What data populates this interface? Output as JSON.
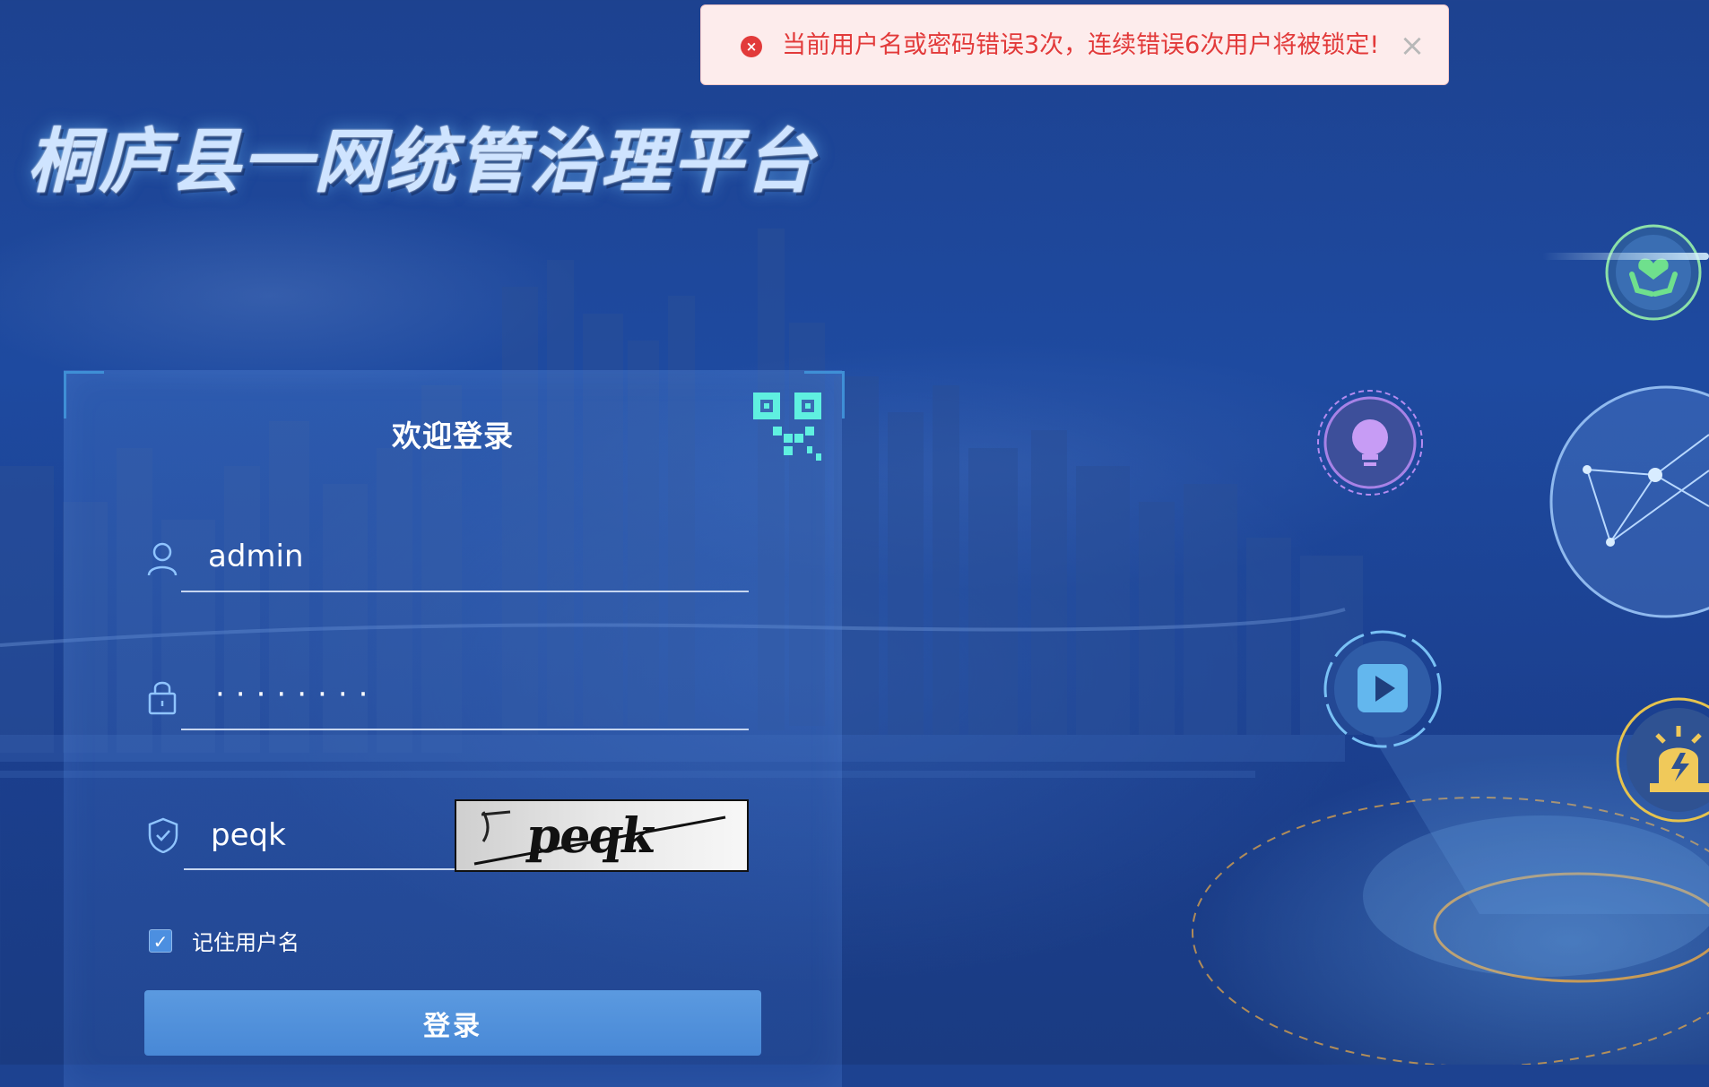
{
  "toast": {
    "message": "当前用户名或密码错误3次，连续错误6次用户将被锁定!",
    "icon": "error-circle-icon",
    "close_icon": "close-icon",
    "color": "#e23a3a",
    "background": "#fdecec"
  },
  "header": {
    "title": "桐庐县一网统管治理平台"
  },
  "login": {
    "title": "欢迎登录",
    "qr_icon": "qr-code-icon",
    "username": {
      "value": "admin",
      "icon": "user-icon"
    },
    "password": {
      "value": "········",
      "icon": "lock-icon"
    },
    "captcha": {
      "value": "peqk",
      "icon": "shield-check-icon",
      "image_text": "peqk"
    },
    "remember": {
      "label": "记住用户名",
      "checked": true
    },
    "submit_label": "登录"
  },
  "decorations": {
    "icons": [
      "hands-heart-icon",
      "lightbulb-icon",
      "play-icon",
      "alarm-light-icon",
      "network-globe-icon"
    ]
  },
  "colors": {
    "accent": "#4888d6",
    "background": "#1e4aa0",
    "title": "#cfe4ff"
  }
}
